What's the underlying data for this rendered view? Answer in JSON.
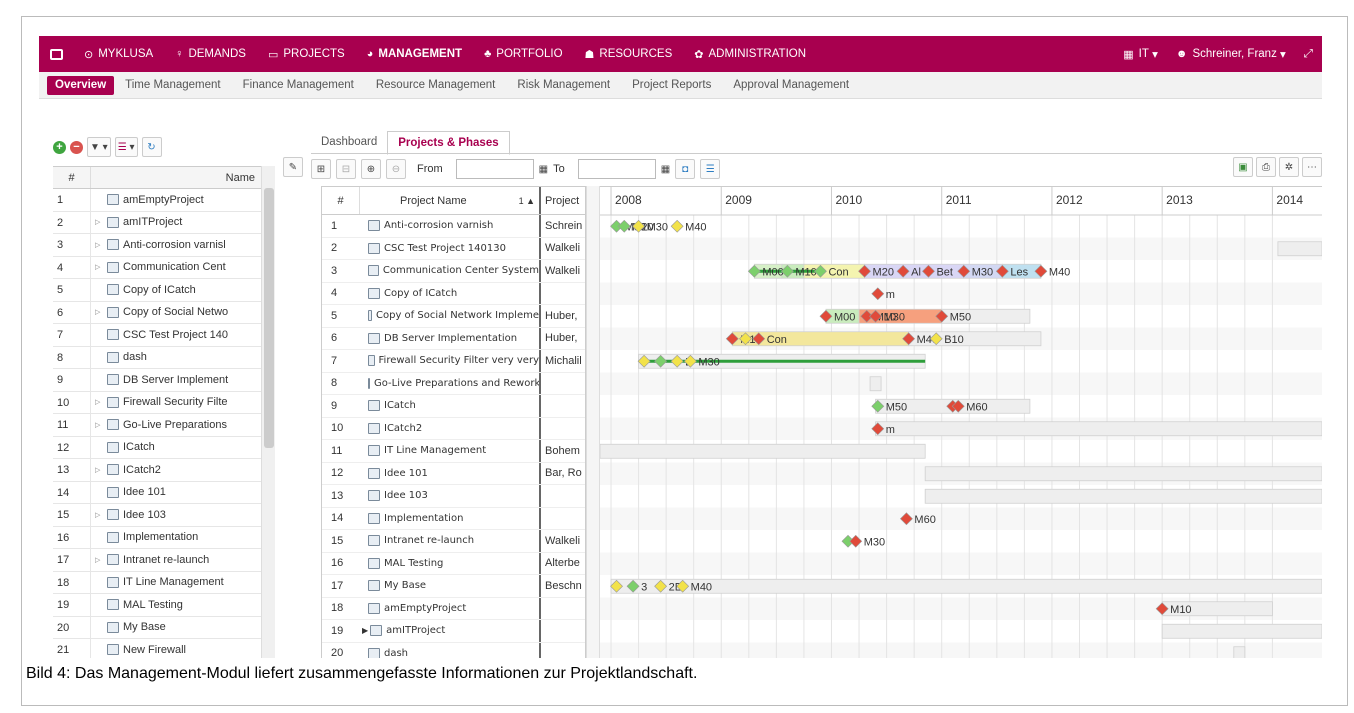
{
  "topnav": {
    "items": [
      {
        "icon": "clock-circle-icon",
        "glyph": "⊙",
        "label": "MYKLUSA"
      },
      {
        "icon": "lightbulb-icon",
        "glyph": "♀",
        "label": "DEMANDS"
      },
      {
        "icon": "calendar-icon",
        "glyph": "▭",
        "label": "PROJECTS"
      },
      {
        "icon": "pie-chart-icon",
        "glyph": "◕",
        "label": "MANAGEMENT",
        "active": true
      },
      {
        "icon": "sitemap-icon",
        "glyph": "♣",
        "label": "PORTFOLIO"
      },
      {
        "icon": "users-icon",
        "glyph": "☗",
        "label": "RESOURCES"
      },
      {
        "icon": "cog-icon",
        "glyph": "✿",
        "label": "ADMINISTRATION"
      }
    ],
    "right": {
      "it_label": "IT",
      "user_label": "Schreiner, Franz"
    },
    "color": "#a8004f"
  },
  "subnav": {
    "items": [
      "Overview",
      "Time Management",
      "Finance Management",
      "Resource Management",
      "Risk Management",
      "Project Reports",
      "Approval Management"
    ],
    "active": "Overview"
  },
  "left_grid": {
    "col_num": "#",
    "col_name": "Name",
    "rows": [
      {
        "n": "1",
        "name": "amEmptyProject",
        "exp": false
      },
      {
        "n": "2",
        "name": "amITProject",
        "exp": true
      },
      {
        "n": "3",
        "name": "Anti-corrosion varnisl",
        "exp": true
      },
      {
        "n": "4",
        "name": "Communication Cent",
        "exp": true
      },
      {
        "n": "5",
        "name": "Copy of ICatch",
        "exp": false
      },
      {
        "n": "6",
        "name": "Copy of Social Netwo",
        "exp": true
      },
      {
        "n": "7",
        "name": "CSC Test Project 140",
        "exp": false
      },
      {
        "n": "8",
        "name": "dash",
        "exp": false
      },
      {
        "n": "9",
        "name": "DB Server Implement",
        "exp": false
      },
      {
        "n": "10",
        "name": "Firewall Security Filte",
        "exp": true
      },
      {
        "n": "11",
        "name": "Go-Live Preparations",
        "exp": true
      },
      {
        "n": "12",
        "name": "ICatch",
        "exp": false
      },
      {
        "n": "13",
        "name": "ICatch2",
        "exp": true
      },
      {
        "n": "14",
        "name": "Idee 101",
        "exp": false
      },
      {
        "n": "15",
        "name": "Idee 103",
        "exp": true
      },
      {
        "n": "16",
        "name": "Implementation",
        "exp": false
      },
      {
        "n": "17",
        "name": "Intranet re-launch",
        "exp": true
      },
      {
        "n": "18",
        "name": "IT Line Management",
        "exp": false
      },
      {
        "n": "19",
        "name": "MAL Testing",
        "exp": false
      },
      {
        "n": "20",
        "name": "My Base",
        "exp": false
      },
      {
        "n": "21",
        "name": "New Firewall",
        "exp": false
      }
    ]
  },
  "tabs": [
    "Dashboard",
    "Projects & Phases"
  ],
  "active_tab": "Projects & Phases",
  "gantt_toolbar": {
    "from_label": "From",
    "to_label": "To"
  },
  "gantt_grid": {
    "col_num": "#",
    "col_name": "Project Name",
    "sort_label": "1 ▲",
    "col_project": "Project",
    "rows": [
      {
        "n": "1",
        "name": "Anti-corrosion varnish",
        "pm": "Schrein"
      },
      {
        "n": "2",
        "name": "CSC Test Project 140130",
        "pm": "Walkeli"
      },
      {
        "n": "3",
        "name": "Communication Center System",
        "pm": "Walkeli"
      },
      {
        "n": "4",
        "name": "Copy of ICatch",
        "pm": ""
      },
      {
        "n": "5",
        "name": "Copy of Social Network Impleme",
        "pm": "Huber,"
      },
      {
        "n": "6",
        "name": "DB Server Implementation",
        "pm": "Huber,"
      },
      {
        "n": "7",
        "name": "Firewall Security Filter very very",
        "pm": "Michalil"
      },
      {
        "n": "8",
        "name": "Go-Live Preparations and Rework",
        "pm": ""
      },
      {
        "n": "9",
        "name": "ICatch",
        "pm": ""
      },
      {
        "n": "10",
        "name": "ICatch2",
        "pm": ""
      },
      {
        "n": "11",
        "name": "IT Line Management",
        "pm": "Bohem"
      },
      {
        "n": "12",
        "name": "Idee 101",
        "pm": "Bar, Ro"
      },
      {
        "n": "13",
        "name": "Idee 103",
        "pm": ""
      },
      {
        "n": "14",
        "name": "Implementation",
        "pm": ""
      },
      {
        "n": "15",
        "name": "Intranet re-launch",
        "pm": "Walkeli"
      },
      {
        "n": "16",
        "name": "MAL Testing",
        "pm": "Alterbe"
      },
      {
        "n": "17",
        "name": "My Base",
        "pm": "Beschn"
      },
      {
        "n": "18",
        "name": "amEmptyProject",
        "pm": ""
      },
      {
        "n": "19",
        "name": "amITProject",
        "pm": "",
        "exp": true
      },
      {
        "n": "20",
        "name": "dash",
        "pm": ""
      }
    ]
  },
  "timeline": {
    "years": [
      "2008",
      "2009",
      "2010",
      "2011",
      "2012",
      "2013",
      "2014"
    ],
    "start_year": 2007.9,
    "end_year": 2014.45,
    "rows": [
      {
        "bars": [],
        "ms": [
          {
            "t": 2008.05,
            "k": "d-green",
            "l": "M00"
          },
          {
            "t": 2008.12,
            "k": "d-green",
            "l": "M20"
          },
          {
            "t": 2008.25,
            "k": "d-yellow",
            "l": "M30"
          },
          {
            "t": 2008.6,
            "k": "d-yellow",
            "l": "M40"
          }
        ]
      },
      {
        "bars": [
          {
            "s": 2014.05,
            "e": 2014.45,
            "c": "#eeeeee"
          }
        ],
        "ms": []
      },
      {
        "bars": [
          {
            "s": 2009.3,
            "e": 2009.55,
            "c": "#d6f0c7"
          },
          {
            "s": 2009.55,
            "e": 2009.75,
            "c": "#c9ecbd"
          },
          {
            "s": 2009.75,
            "e": 2010.3,
            "c": "#f4f4b0"
          },
          {
            "s": 2010.3,
            "e": 2011.2,
            "c": "#d9d6f5"
          },
          {
            "s": 2011.2,
            "e": 2011.55,
            "c": "#d3d8f3"
          },
          {
            "s": 2011.55,
            "e": 2011.9,
            "c": "#bfe0f0"
          }
        ],
        "line": {
          "s": 2009.3,
          "e": 2009.9
        },
        "ms": [
          {
            "t": 2009.3,
            "k": "d-green",
            "l": "M00"
          },
          {
            "t": 2009.6,
            "k": "d-green",
            "l": "M10"
          },
          {
            "t": 2009.9,
            "k": "d-green",
            "l": "Con"
          },
          {
            "t": 2010.3,
            "k": "d-red",
            "l": "M20"
          },
          {
            "t": 2010.65,
            "k": "d-red",
            "l": "Al"
          },
          {
            "t": 2010.88,
            "k": "d-red",
            "l": "Bet"
          },
          {
            "t": 2011.2,
            "k": "d-red",
            "l": "M30"
          },
          {
            "t": 2011.55,
            "k": "d-red",
            "l": "Les"
          },
          {
            "t": 2011.9,
            "k": "d-red",
            "l": "M40"
          }
        ]
      },
      {
        "bars": [],
        "ms": [
          {
            "t": 2010.42,
            "k": "d-red",
            "l": "m"
          }
        ]
      },
      {
        "bars": [
          {
            "s": 2009.95,
            "e": 2010.25,
            "c": "#c9ecbd"
          },
          {
            "s": 2010.25,
            "e": 2011.0,
            "c": "#f6a07e"
          },
          {
            "s": 2011.0,
            "e": 2011.8,
            "c": "#eeeeee"
          }
        ],
        "ms": [
          {
            "t": 2009.95,
            "k": "d-red",
            "l": "M00"
          },
          {
            "t": 2010.32,
            "k": "d-red",
            "l": "M10"
          },
          {
            "t": 2010.4,
            "k": "d-red",
            "l": "M30"
          },
          {
            "t": 2011.0,
            "k": "d-red",
            "l": "M50"
          }
        ]
      },
      {
        "bars": [
          {
            "s": 2009.1,
            "e": 2010.7,
            "c": "#f3e79c"
          },
          {
            "s": 2010.7,
            "e": 2011.9,
            "c": "#eeeeee"
          }
        ],
        "ms": [
          {
            "t": 2009.1,
            "k": "d-red",
            "l": "M10"
          },
          {
            "t": 2009.22,
            "k": "d-yellow",
            "l": ""
          },
          {
            "t": 2009.34,
            "k": "d-red",
            "l": "Con"
          },
          {
            "t": 2010.7,
            "k": "d-red",
            "l": "M40"
          },
          {
            "t": 2010.95,
            "k": "d-yellow",
            "l": "B10"
          }
        ]
      },
      {
        "bars": [
          {
            "s": 2008.25,
            "e": 2010.85,
            "c": "#eeeeee"
          }
        ],
        "line": {
          "s": 2008.3,
          "e": 2010.85
        },
        "ms": [
          {
            "t": 2008.3,
            "k": "d-yellow",
            "l": ""
          },
          {
            "t": 2008.45,
            "k": "d-green",
            "l": ""
          },
          {
            "t": 2008.6,
            "k": "d-yellow",
            "l": "B"
          },
          {
            "t": 2008.72,
            "k": "d-yellow",
            "l": "M30"
          }
        ]
      },
      {
        "bars": [
          {
            "s": 2010.35,
            "e": 2010.45,
            "c": "#eeeeee"
          }
        ],
        "ms": []
      },
      {
        "bars": [
          {
            "s": 2010.4,
            "e": 2011.8,
            "c": "#eeeeee"
          }
        ],
        "ms": [
          {
            "t": 2010.42,
            "k": "d-green",
            "l": "M50"
          },
          {
            "t": 2011.1,
            "k": "d-red",
            "l": ""
          },
          {
            "t": 2011.15,
            "k": "d-red",
            "l": "M60"
          }
        ]
      },
      {
        "bars": [
          {
            "s": 2010.4,
            "e": 2014.45,
            "c": "#eeeeee"
          }
        ],
        "ms": [
          {
            "t": 2010.42,
            "k": "d-red",
            "l": "m"
          }
        ]
      },
      {
        "bars": [
          {
            "s": 2007.9,
            "e": 2010.85,
            "c": "#eeeeee"
          }
        ],
        "ms": []
      },
      {
        "bars": [
          {
            "s": 2010.85,
            "e": 2014.45,
            "c": "#eeeeee"
          }
        ],
        "ms": []
      },
      {
        "bars": [
          {
            "s": 2010.85,
            "e": 2014.45,
            "c": "#eeeeee"
          }
        ],
        "ms": []
      },
      {
        "bars": [],
        "ms": [
          {
            "t": 2010.68,
            "k": "d-red",
            "l": "M60"
          }
        ]
      },
      {
        "bars": [],
        "ms": [
          {
            "t": 2010.15,
            "k": "d-green",
            "l": ""
          },
          {
            "t": 2010.22,
            "k": "d-red",
            "l": "M30"
          }
        ]
      },
      {
        "bars": [],
        "ms": []
      },
      {
        "bars": [
          {
            "s": 2008.0,
            "e": 2014.45,
            "c": "#eeeeee"
          }
        ],
        "ms": [
          {
            "t": 2008.05,
            "k": "d-yellow",
            "l": ""
          },
          {
            "t": 2008.2,
            "k": "d-green",
            "l": "3"
          },
          {
            "t": 2008.45,
            "k": "d-yellow",
            "l": "2E"
          },
          {
            "t": 2008.65,
            "k": "d-yellow",
            "l": "M40"
          }
        ]
      },
      {
        "bars": [
          {
            "s": 2013.0,
            "e": 2014.0,
            "c": "#eeeeee"
          }
        ],
        "ms": [
          {
            "t": 2013.0,
            "k": "d-red",
            "l": "M10"
          }
        ]
      },
      {
        "bars": [
          {
            "s": 2013.0,
            "e": 2014.45,
            "c": "#eeeeee"
          }
        ],
        "ms": []
      },
      {
        "bars": [
          {
            "s": 2013.65,
            "e": 2013.75,
            "c": "#eeeeee"
          }
        ],
        "ms": []
      }
    ]
  },
  "caption": "Bild 4: Das Management-Modul liefert zusammengefasste Informationen zur Projektlandschaft."
}
